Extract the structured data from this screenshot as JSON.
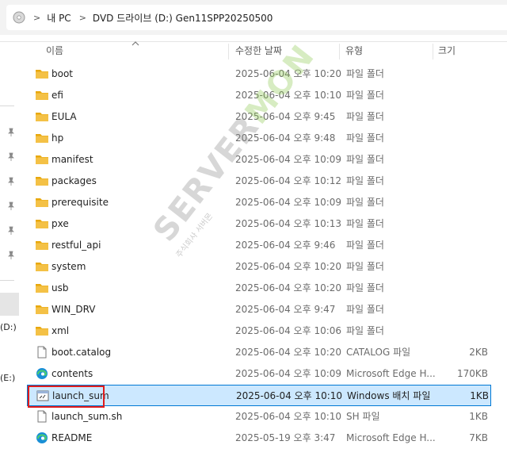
{
  "address": {
    "crumbs": [
      "내 PC",
      "DVD 드라이브 (D:) Gen11SPP20250500"
    ]
  },
  "columns": {
    "name": "이름",
    "date": "수정한 날짜",
    "type": "유형",
    "size": "크기"
  },
  "nav": {
    "drive_d": "(D:)",
    "drive_e": "(E:)"
  },
  "files": [
    {
      "name": "boot",
      "date": "2025-06-04 오후 10:20",
      "type": "파일 폴더",
      "size": "",
      "icon": "folder-icon"
    },
    {
      "name": "efi",
      "date": "2025-06-04 오후 10:10",
      "type": "파일 폴더",
      "size": "",
      "icon": "folder-icon"
    },
    {
      "name": "EULA",
      "date": "2025-06-04 오후 9:45",
      "type": "파일 폴더",
      "size": "",
      "icon": "folder-icon"
    },
    {
      "name": "hp",
      "date": "2025-06-04 오후 9:48",
      "type": "파일 폴더",
      "size": "",
      "icon": "folder-icon"
    },
    {
      "name": "manifest",
      "date": "2025-06-04 오후 10:09",
      "type": "파일 폴더",
      "size": "",
      "icon": "folder-icon"
    },
    {
      "name": "packages",
      "date": "2025-06-04 오후 10:12",
      "type": "파일 폴더",
      "size": "",
      "icon": "folder-icon"
    },
    {
      "name": "prerequisite",
      "date": "2025-06-04 오후 10:09",
      "type": "파일 폴더",
      "size": "",
      "icon": "folder-icon"
    },
    {
      "name": "pxe",
      "date": "2025-06-04 오후 10:13",
      "type": "파일 폴더",
      "size": "",
      "icon": "folder-icon"
    },
    {
      "name": "restful_api",
      "date": "2025-06-04 오후 9:46",
      "type": "파일 폴더",
      "size": "",
      "icon": "folder-icon"
    },
    {
      "name": "system",
      "date": "2025-06-04 오후 10:20",
      "type": "파일 폴더",
      "size": "",
      "icon": "folder-icon"
    },
    {
      "name": "usb",
      "date": "2025-06-04 오후 10:20",
      "type": "파일 폴더",
      "size": "",
      "icon": "folder-icon"
    },
    {
      "name": "WIN_DRV",
      "date": "2025-06-04 오후 9:47",
      "type": "파일 폴더",
      "size": "",
      "icon": "folder-icon"
    },
    {
      "name": "xml",
      "date": "2025-06-04 오후 10:06",
      "type": "파일 폴더",
      "size": "",
      "icon": "folder-icon"
    },
    {
      "name": "boot.catalog",
      "date": "2025-06-04 오후 10:20",
      "type": "CATALOG 파일",
      "size": "2KB",
      "icon": "file-icon"
    },
    {
      "name": "contents",
      "date": "2025-06-04 오후 10:09",
      "type": "Microsoft Edge H...",
      "size": "170KB",
      "icon": "edge-icon"
    },
    {
      "name": "launch_sum",
      "date": "2025-06-04 오후 10:10",
      "type": "Windows 배치 파일",
      "size": "1KB",
      "icon": "batch-file-icon",
      "selected": true
    },
    {
      "name": "launch_sum.sh",
      "date": "2025-06-04 오후 10:10",
      "type": "SH 파일",
      "size": "1KB",
      "icon": "file-icon"
    },
    {
      "name": "README",
      "date": "2025-05-19 오후 3:47",
      "type": "Microsoft Edge H...",
      "size": "7KB",
      "icon": "edge-icon"
    }
  ],
  "watermark": {
    "main": "SERVER",
    "accent": "MON",
    "sub": "주식회사 서버몬"
  },
  "colors": {
    "selection_fill": "#cce8ff",
    "selection_border": "#0078d4",
    "highlight": "#e01b1b",
    "folder": "#f4c146"
  }
}
